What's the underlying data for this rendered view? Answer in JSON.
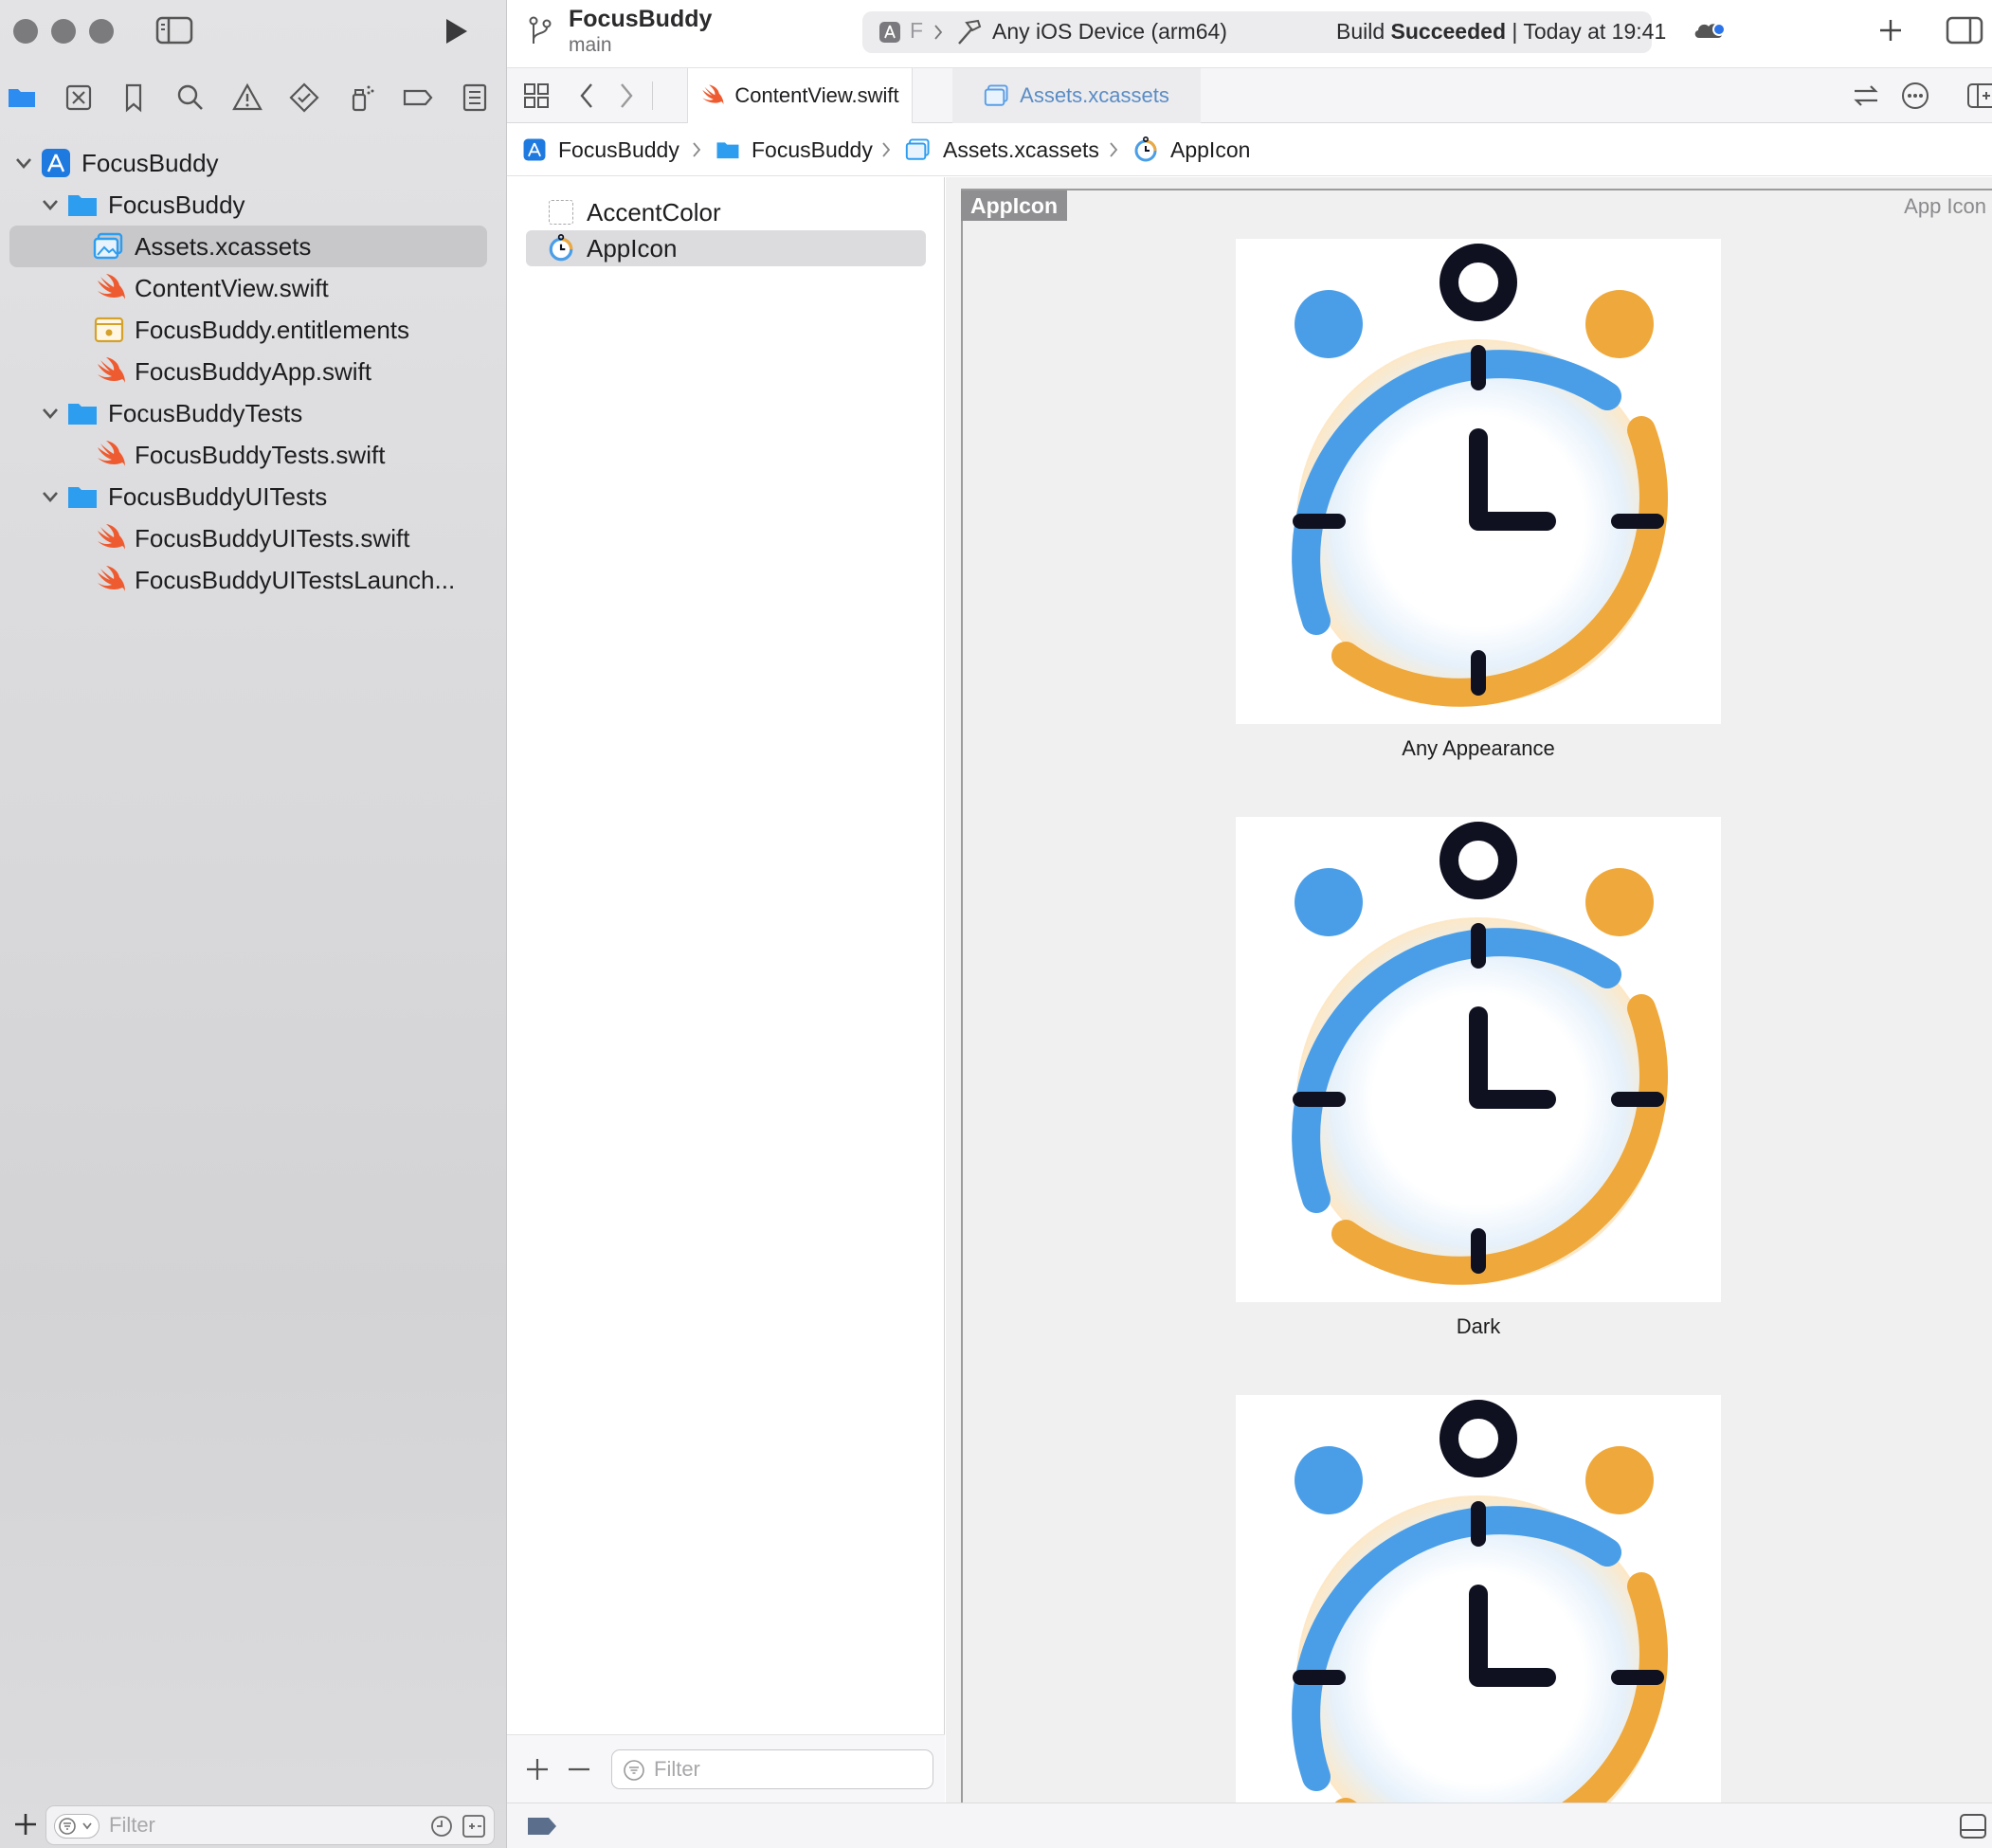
{
  "window": {
    "project_name": "FocusBuddy",
    "branch": "main"
  },
  "toolbar": {
    "scheme_short": "F",
    "destination": "Any iOS Device (arm64)",
    "build_prefix": "Build ",
    "build_status": "Succeeded",
    "build_time": "| Today at 19:41"
  },
  "tabs": [
    {
      "label": "ContentView.swift",
      "active": true
    },
    {
      "label": "Assets.xcassets",
      "active": false
    }
  ],
  "breadcrumb": [
    "FocusBuddy",
    "FocusBuddy",
    "Assets.xcassets",
    "AppIcon"
  ],
  "navigator": {
    "items": [
      {
        "label": "FocusBuddy",
        "kind": "project",
        "level": 0,
        "expanded": true
      },
      {
        "label": "FocusBuddy",
        "kind": "folder",
        "level": 1,
        "expanded": true
      },
      {
        "label": "Assets.xcassets",
        "kind": "assets",
        "level": 2,
        "selected": true
      },
      {
        "label": "ContentView.swift",
        "kind": "swift",
        "level": 2
      },
      {
        "label": "FocusBuddy.entitlements",
        "kind": "entitlements",
        "level": 2
      },
      {
        "label": "FocusBuddyApp.swift",
        "kind": "swift",
        "level": 2
      },
      {
        "label": "FocusBuddyTests",
        "kind": "folder",
        "level": 1,
        "expanded": true
      },
      {
        "label": "FocusBuddyTests.swift",
        "kind": "swift",
        "level": 2
      },
      {
        "label": "FocusBuddyUITests",
        "kind": "folder",
        "level": 1,
        "expanded": true
      },
      {
        "label": "FocusBuddyUITests.swift",
        "kind": "swift",
        "level": 2
      },
      {
        "label": "FocusBuddyUITestsLaunch...",
        "kind": "swift",
        "level": 2
      }
    ],
    "filter_placeholder": "Filter"
  },
  "asset_list": {
    "items": [
      {
        "label": "AccentColor",
        "selected": false
      },
      {
        "label": "AppIcon",
        "selected": true
      }
    ],
    "filter_placeholder": "Filter"
  },
  "canvas": {
    "set_name": "AppIcon",
    "set_type": "App Icon",
    "variants": [
      "Any Appearance",
      "Dark",
      ""
    ]
  },
  "colors": {
    "accent_blue": "#4a9ee8",
    "accent_orange": "#efa83b",
    "dark": "#0f1120",
    "swift_orange": "#ef5b30",
    "folder_blue": "#2d9df0"
  }
}
